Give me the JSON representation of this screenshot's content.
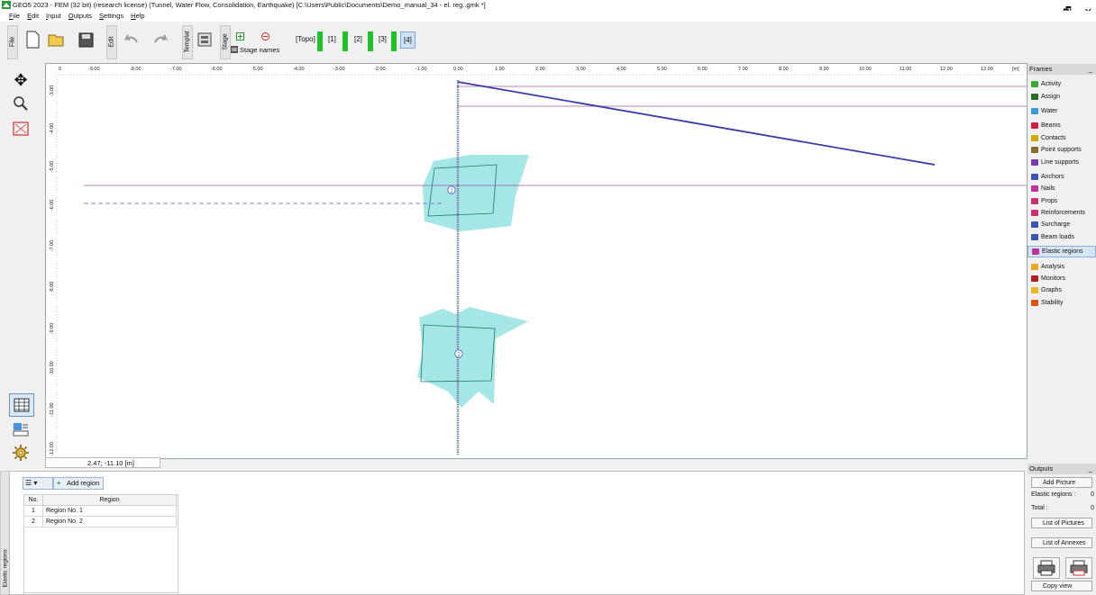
{
  "window": {
    "title": "GEO5 2023 - FEM (32 bit) (research license) (Tunnel, Water Flow, Consolidation, Earthquake) [C:\\Users\\Public\\Documents\\Demo_manual_34 - el. reg..gmk *]",
    "minimize": "_",
    "restore": "🗗",
    "close": "✕"
  },
  "menu": [
    "File",
    "Edit",
    "Input",
    "Outputs",
    "Settings",
    "Help"
  ],
  "toolbar": {
    "file_tab": "File",
    "edit_tab": "Edit",
    "templates_tab": "Templat",
    "stage_tab": "Stage",
    "stage_names": "Stage names",
    "stages": [
      "[Topo]",
      "[1]",
      "[2]",
      "[3]",
      "[4]"
    ]
  },
  "canvas": {
    "x_ticks": [
      "0",
      "-9.00",
      "-8.00",
      "-7.00",
      "-6.00",
      "-5.00",
      "-4.00",
      "-3.00",
      "-2.00",
      "-1.00",
      "0.00",
      "1.00",
      "2.00",
      "3.00",
      "4.00",
      "5.00",
      "6.00",
      "7.00",
      "8.00",
      "9.00",
      "10.00",
      "11.00",
      "12.00",
      "13.00",
      "[m]"
    ],
    "y_ticks": [
      "-3.00",
      "-4.00",
      "-5.00",
      "-6.00",
      "-7.00",
      "-8.00",
      "-9.00",
      "-10.00",
      "-11.00",
      "-12.00"
    ],
    "region_labels": [
      "1",
      "2"
    ],
    "coordinates": "2.47; -11.10 [m]"
  },
  "frames": {
    "title": "Frames",
    "items": [
      {
        "label": "Activity",
        "icon": "activity-icon",
        "color": "#3aa832"
      },
      {
        "label": "Assign",
        "icon": "assign-icon",
        "color": "#2d6b2a"
      },
      {
        "label": "Water",
        "icon": "water-icon",
        "color": "#3a9ad8"
      },
      {
        "label": "Beams",
        "icon": "beams-icon",
        "color": "#cc2244"
      },
      {
        "label": "Contacts",
        "icon": "contacts-icon",
        "color": "#d4a800"
      },
      {
        "label": "Point supports",
        "icon": "point-supports-icon",
        "color": "#8a6a2a"
      },
      {
        "label": "Line supports",
        "icon": "line-supports-icon",
        "color": "#7a3ab0"
      },
      {
        "label": "Anchors",
        "icon": "anchors-icon",
        "color": "#3a56b0"
      },
      {
        "label": "Nails",
        "icon": "nails-icon",
        "color": "#c030a0"
      },
      {
        "label": "Props",
        "icon": "props-icon",
        "color": "#c83070"
      },
      {
        "label": "Reinforcements",
        "icon": "reinforcements-icon",
        "color": "#c83070"
      },
      {
        "label": "Surcharge",
        "icon": "surcharge-icon",
        "color": "#3a56b0"
      },
      {
        "label": "Beam loads",
        "icon": "beam-loads-icon",
        "color": "#3a56b0"
      },
      {
        "label": "Elastic regions",
        "icon": "elastic-regions-icon",
        "color": "#c030a0"
      },
      {
        "label": "Analysis",
        "icon": "analysis-icon",
        "color": "#e8a820"
      },
      {
        "label": "Monitors",
        "icon": "monitors-icon",
        "color": "#b02020"
      },
      {
        "label": "Graphs",
        "icon": "graphs-icon",
        "color": "#e8b820"
      },
      {
        "label": "Stability",
        "icon": "stability-icon",
        "color": "#e05010"
      }
    ]
  },
  "bottom": {
    "panel_tab": "Elastic regions",
    "add_region": "Add region",
    "columns": [
      "No.",
      "Region"
    ],
    "rows": [
      {
        "no": "1",
        "region": "Region No. 1"
      },
      {
        "no": "2",
        "region": "Region No. 2"
      }
    ]
  },
  "outputs": {
    "title": "Outputs",
    "add_picture": "Add Picture",
    "elastic_regions_label": "Elastic regions :",
    "elastic_regions_value": "0",
    "total_label": "Total :",
    "total_value": "0",
    "list_pictures": "List of Pictures",
    "list_annexes": "List of Annexes",
    "copy_view": "Copy view"
  }
}
